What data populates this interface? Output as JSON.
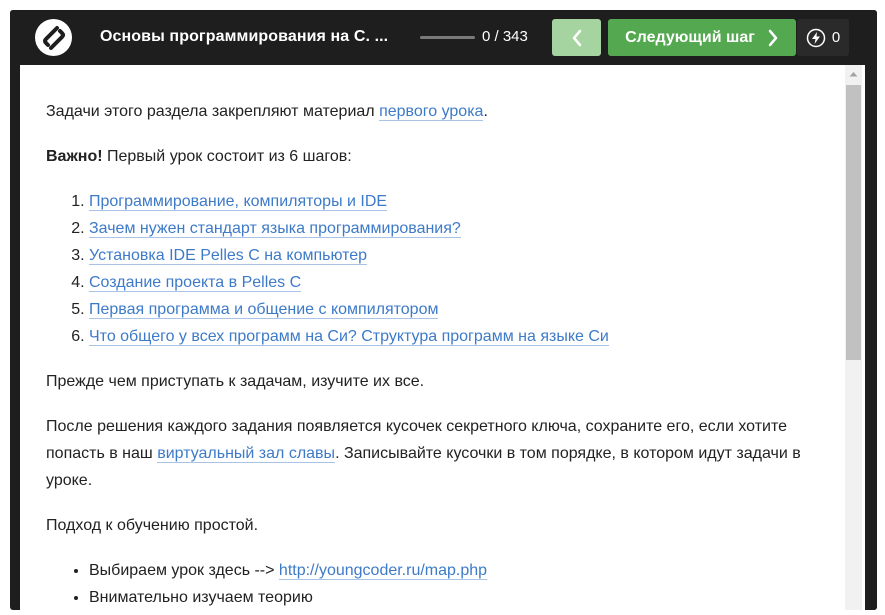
{
  "header": {
    "course_title": "Основы программирования на С. ...",
    "progress": 0.0,
    "progress_text": "0 / 343",
    "prev_icon": "chevron-left-icon",
    "next_label": "Следующий шаг",
    "next_icon": "chevron-right-icon",
    "energy_icon": "lightning-icon",
    "energy_count": "0",
    "colors": {
      "bar_bg": "#1e1e1e",
      "next_bg": "#54a850",
      "prev_bg": "#a5d4a0",
      "link": "#3d7ac8"
    }
  },
  "content": {
    "p1_text": "Задачи этого раздела закрепляют материал ",
    "p1_link": "первого урока",
    "p1_end": ".",
    "p2_bold": "Важно!",
    "p2_text": " Первый урок состоит из 6 шагов:",
    "steps": [
      "Программирование, компиляторы и IDE",
      "Зачем нужен стандарт языка программирования?",
      "Установка IDE Pelles C на компьютер",
      "Создание проекта в Pelles C",
      "Первая программа и общение с компилятором",
      "Что общего у всех программ на Си? Структура программ на языке Си"
    ],
    "p3": "Прежде чем приступать к задачам, изучите их все.",
    "p4_start": "После решения каждого задания появляется кусочек секретного ключа, сохраните его, если хотите попасть в наш ",
    "p4_link": "виртуальный зал славы",
    "p4_end": ". Записывайте кусочки в том порядке, в котором идут задачи в уроке.",
    "p5": "Подход к обучению простой.",
    "bullets": [
      {
        "text": "Выбираем урок здесь --> ",
        "link": "http://youngcoder.ru/map.php"
      },
      {
        "text": "Внимательно изучаем теорию",
        "link": ""
      }
    ]
  }
}
